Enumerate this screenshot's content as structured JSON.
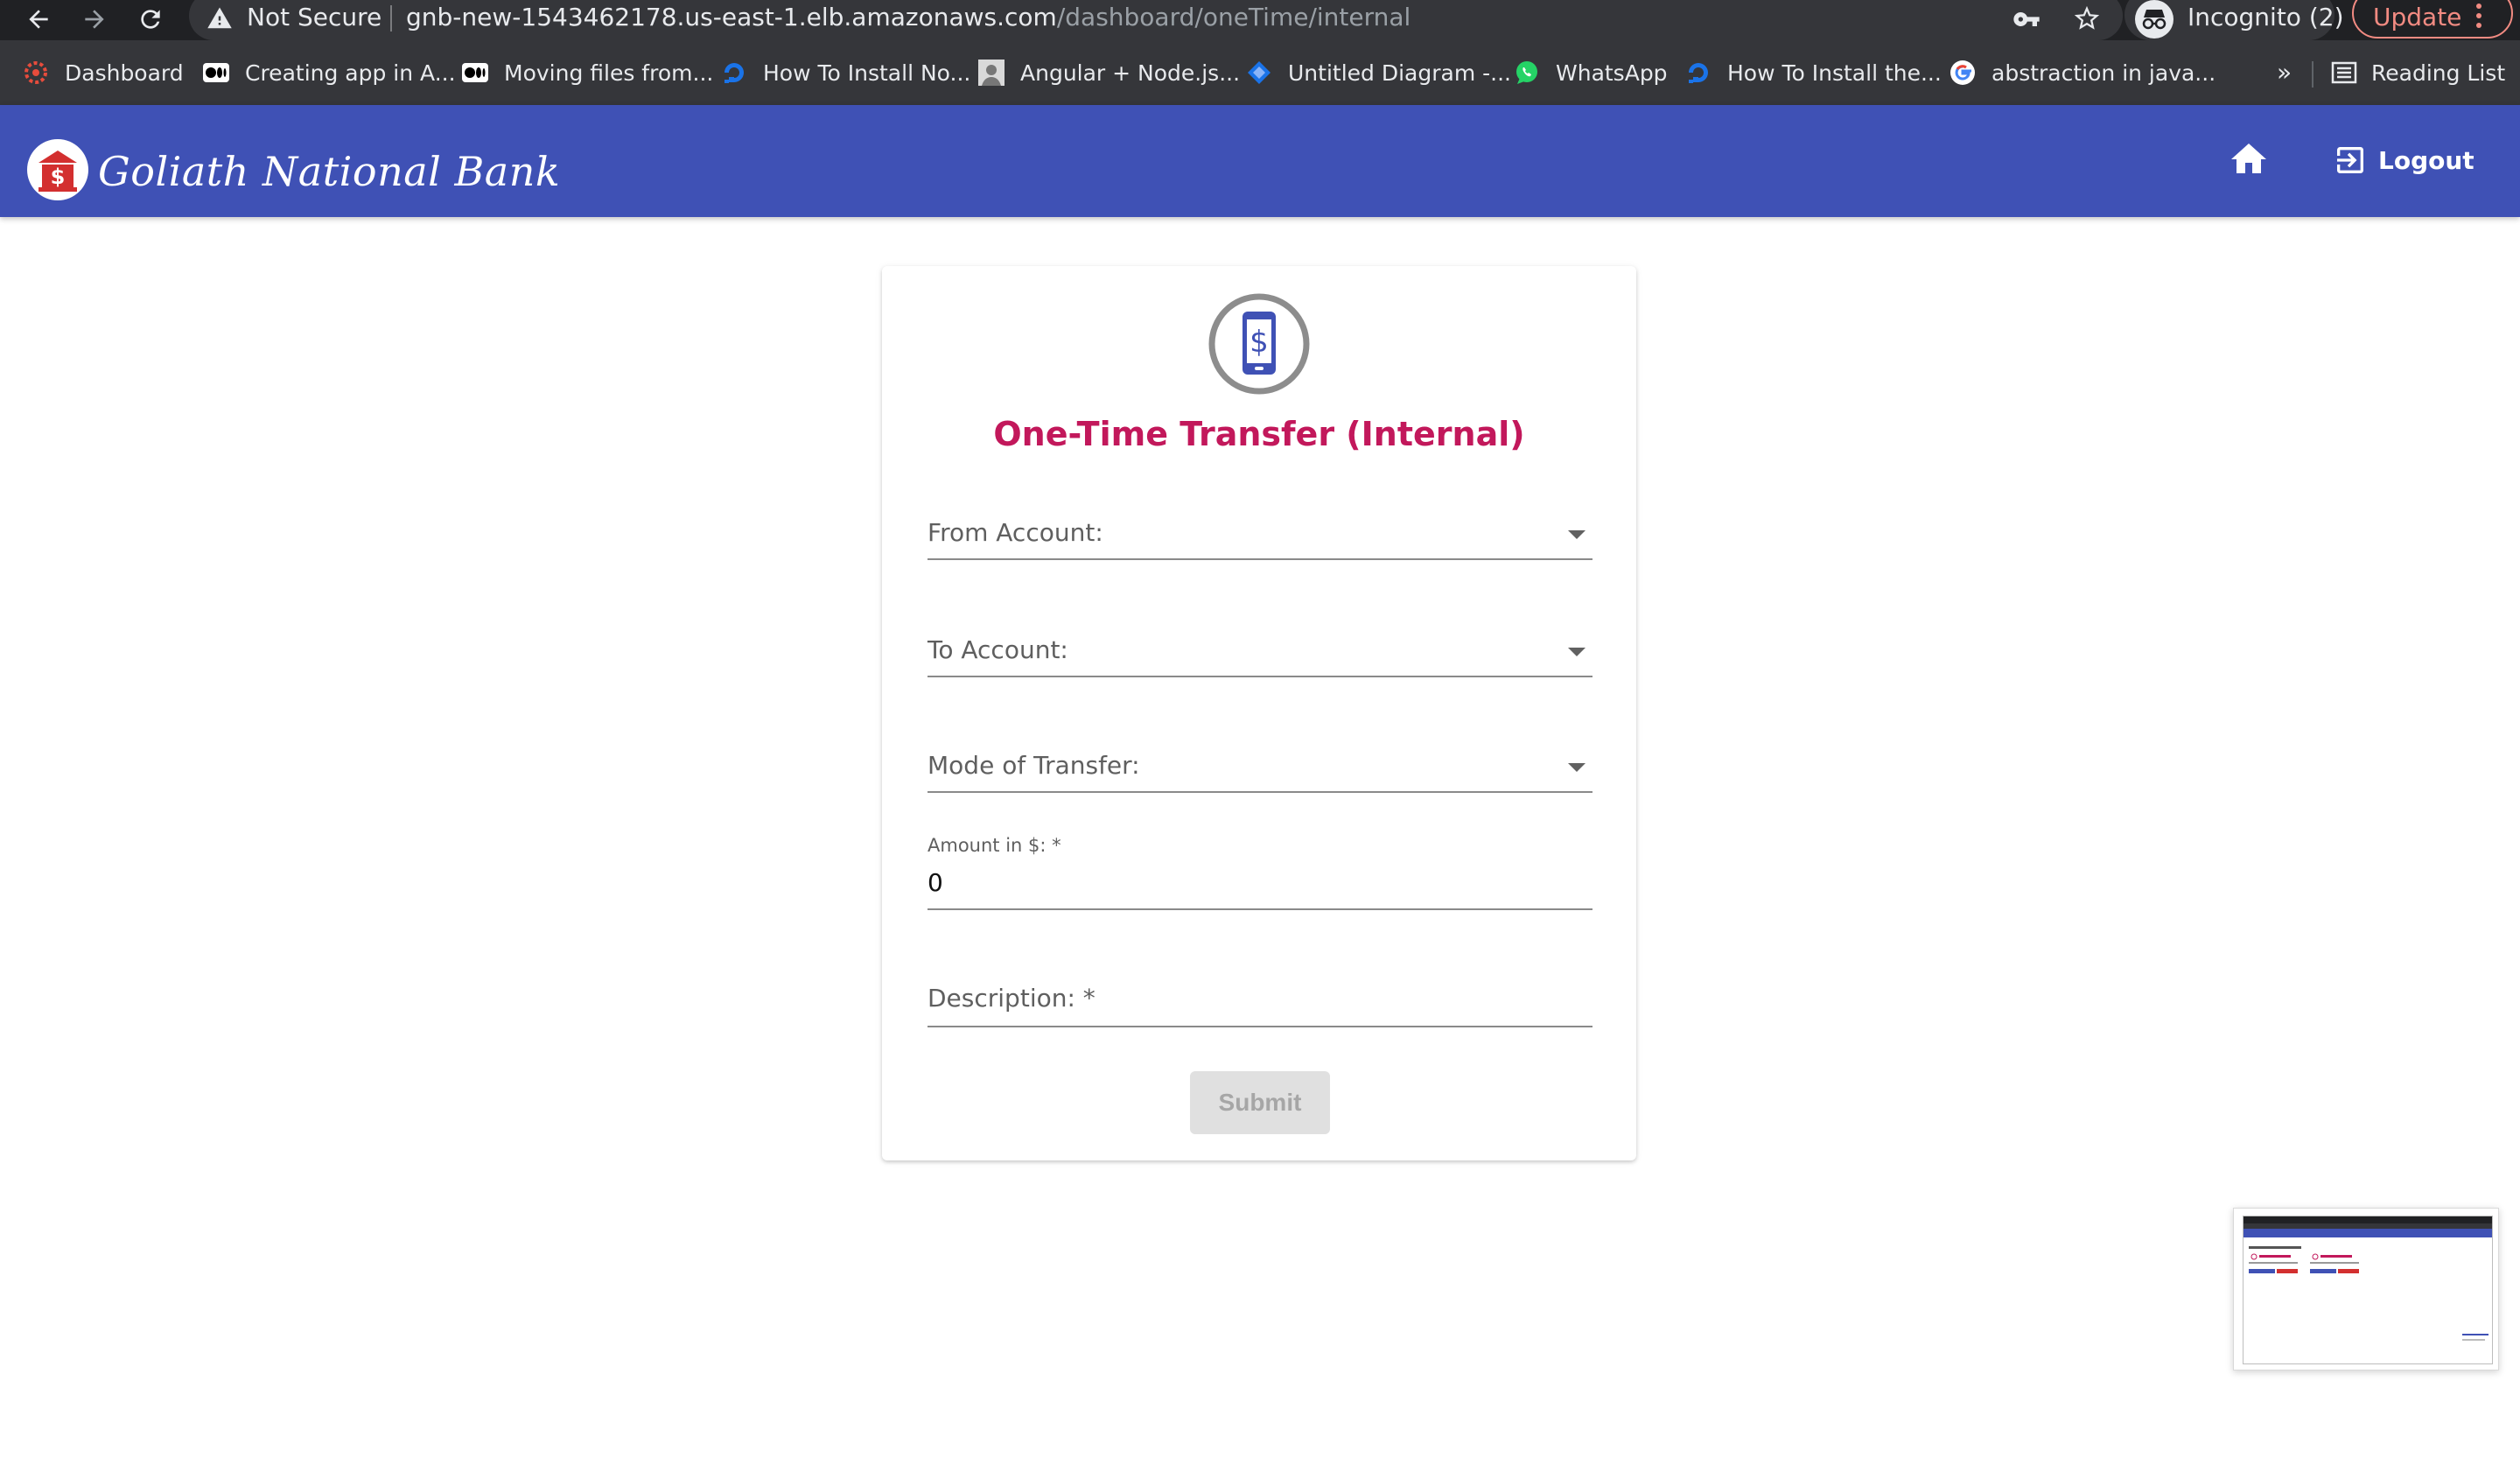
{
  "browser": {
    "security_label": "Not Secure",
    "url_host": "gnb-new-1543462178.us-east-1.elb.amazonaws.com",
    "url_path": "/dashboard/oneTime/internal",
    "profile_label": "Incognito (2)",
    "update_label": "Update",
    "bookmarks": [
      {
        "label": "Dashboard",
        "icon": "angular-icon"
      },
      {
        "label": "Creating app in A...",
        "icon": "medium-icon"
      },
      {
        "label": "Moving files from...",
        "icon": "medium-icon"
      },
      {
        "label": "How To Install No...",
        "icon": "digitalocean-icon"
      },
      {
        "label": "Angular + Node.js...",
        "icon": "avatar-icon"
      },
      {
        "label": "Untitled Diagram -...",
        "icon": "drawio-icon"
      },
      {
        "label": "WhatsApp",
        "icon": "whatsapp-icon"
      },
      {
        "label": "How To Install the...",
        "icon": "digitalocean-icon"
      },
      {
        "label": "abstraction in java...",
        "icon": "google-icon"
      }
    ],
    "bookmarks_overflow": "»",
    "reading_list_label": "Reading List"
  },
  "app": {
    "bank_name": "Goliath National Bank",
    "logout_label": "Logout",
    "brand_color": "#3f51b5",
    "accent_color": "#c2185b"
  },
  "form": {
    "title": "One-Time Transfer (Internal)",
    "from_label": "From Account:",
    "to_label": "To Account:",
    "mode_label": "Mode of Transfer:",
    "amount_label": "Amount in $: *",
    "amount_value": "0",
    "description_label": "Description: *",
    "submit_label": "Submit"
  }
}
